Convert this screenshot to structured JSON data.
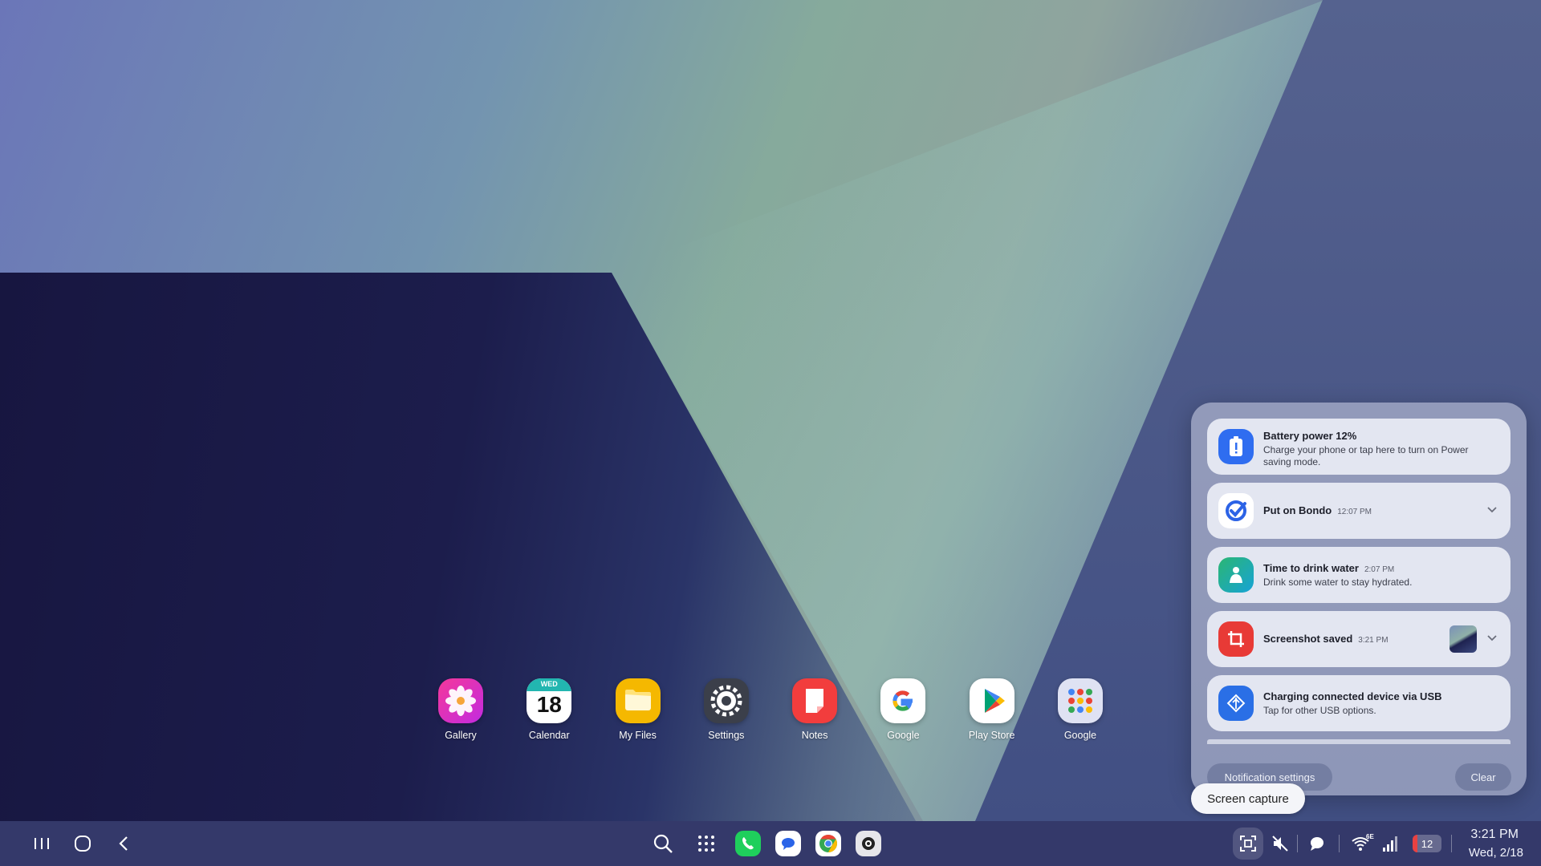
{
  "dock": {
    "apps": [
      {
        "label": "Gallery"
      },
      {
        "label": "Calendar",
        "day_name": "WED",
        "day_number": "18"
      },
      {
        "label": "My Files"
      },
      {
        "label": "Settings"
      },
      {
        "label": "Notes"
      },
      {
        "label": "Google"
      },
      {
        "label": "Play Store"
      },
      {
        "label": "Google"
      }
    ]
  },
  "notifications": [
    {
      "title": "Battery power 12%",
      "time": "",
      "body": "Charge your phone or tap here to turn on Power saving mode.",
      "icon": "battery-alert-icon",
      "color": "#2f6df0"
    },
    {
      "title": "Put on Bondo",
      "time": "12:07 PM",
      "body": "",
      "icon": "reminder-check-icon",
      "color": "#ffffff"
    },
    {
      "title": "Time to drink water",
      "time": "2:07 PM",
      "body": "Drink some water to stay hydrated.",
      "icon": "health-icon",
      "color": "#2bb673"
    },
    {
      "title": "Screenshot saved",
      "time": "3:21 PM",
      "body": "",
      "icon": "screenshot-icon",
      "color": "#e83a36"
    },
    {
      "title": "Charging connected device via USB",
      "time": "",
      "body": "Tap for other USB options.",
      "icon": "usb-icon",
      "color": "#2a6fe6"
    }
  ],
  "notification_actions": {
    "settings_label": "Notification settings",
    "clear_label": "Clear"
  },
  "tooltip": {
    "text": "Screen capture"
  },
  "taskbar": {
    "notification_count": "12",
    "network_label": "6E",
    "time": "3:21 PM",
    "date": "Wed, 2/18"
  }
}
